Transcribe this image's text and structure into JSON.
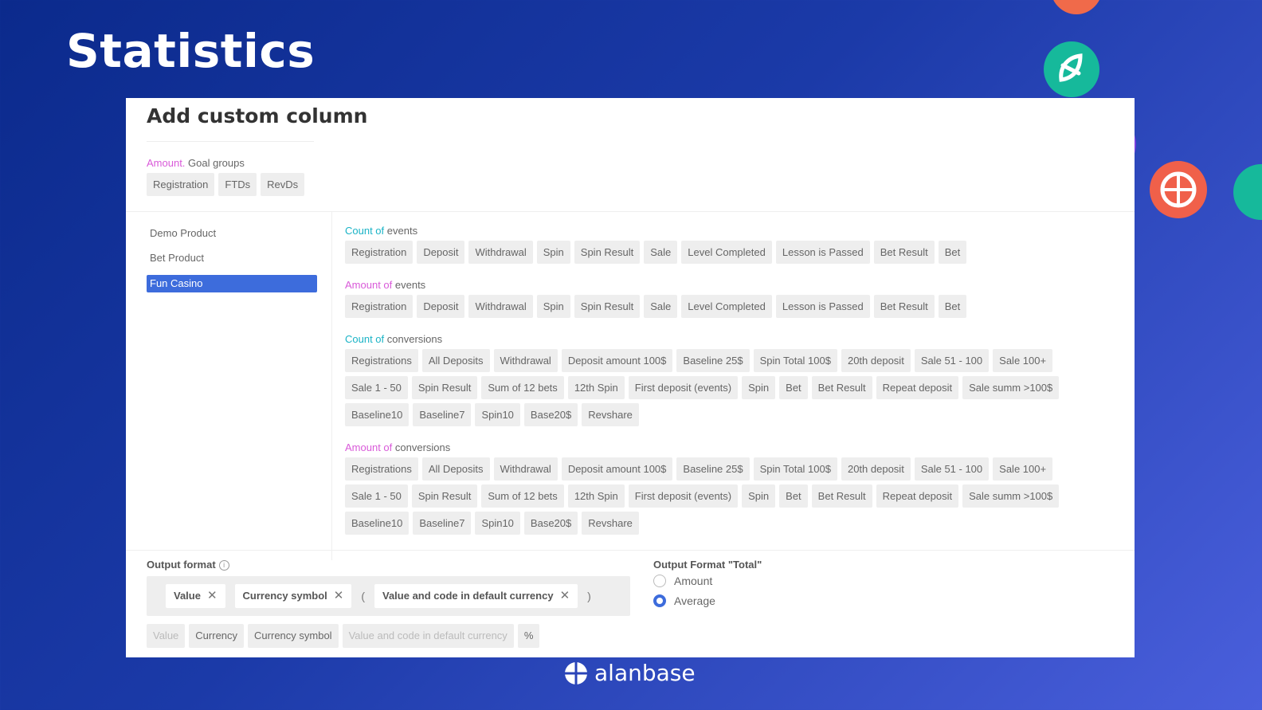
{
  "page": {
    "title": "Statistics"
  },
  "dialog": {
    "title": "Add custom column",
    "goal_groups": {
      "prefix": "Amount.",
      "label": " Goal groups",
      "items": [
        "Registration",
        "FTDs",
        "RevDs"
      ]
    },
    "products": [
      {
        "label": "Demo Product"
      },
      {
        "label": "Bet Product"
      },
      {
        "label": "Fun Casino",
        "selected": true
      }
    ],
    "count_events": {
      "prefix": "Count of",
      "label": " events",
      "items": [
        "Registration",
        "Deposit",
        "Withdrawal",
        "Spin",
        "Spin Result",
        "Sale",
        "Level Completed",
        "Lesson is Passed",
        "Bet Result",
        "Bet"
      ]
    },
    "amount_events": {
      "prefix": "Amount of",
      "label": " events",
      "items": [
        "Registration",
        "Deposit",
        "Withdrawal",
        "Spin",
        "Spin Result",
        "Sale",
        "Level Completed",
        "Lesson is Passed",
        "Bet Result",
        "Bet"
      ]
    },
    "count_conversions": {
      "prefix": "Count of",
      "label": " conversions",
      "items": [
        "Registrations",
        "All Deposits",
        "Withdrawal",
        "Deposit amount 100$",
        "Baseline 25$",
        "Spin Total 100$",
        "20th deposit",
        "Sale 51 - 100",
        "Sale 100+",
        "Sale 1 - 50",
        "Spin Result",
        "Sum of 12 bets",
        "12th Spin",
        "First deposit (events)",
        "Spin",
        "Bet",
        "Bet Result",
        "Repeat deposit",
        "Sale summ >100$",
        "Baseline10",
        "Baseline7",
        "Spin10",
        "Base20$",
        "Revshare"
      ]
    },
    "amount_conversions": {
      "prefix": "Amount of",
      "label": " conversions",
      "items": [
        "Registrations",
        "All Deposits",
        "Withdrawal",
        "Deposit amount 100$",
        "Baseline 25$",
        "Spin Total 100$",
        "20th deposit",
        "Sale 51 - 100",
        "Sale 100+",
        "Sale 1 - 50",
        "Spin Result",
        "Sum of 12 bets",
        "12th Spin",
        "First deposit (events)",
        "Spin",
        "Bet",
        "Bet Result",
        "Repeat deposit",
        "Sale summ >100$",
        "Baseline10",
        "Baseline7",
        "Spin10",
        "Base20$",
        "Revshare"
      ]
    },
    "output_format": {
      "label": "Output format",
      "info_icon": "i",
      "tags": [
        "Value",
        "Currency symbol",
        "Value and code in default currency"
      ],
      "close_glyph": "✕",
      "open_paren": "(",
      "close_paren": ")",
      "options": [
        {
          "label": "Value",
          "disabled": true
        },
        {
          "label": "Currency",
          "disabled": false
        },
        {
          "label": "Currency symbol",
          "disabled": false
        },
        {
          "label": "Value and code in default currency",
          "disabled": true
        },
        {
          "label": "%",
          "disabled": false
        }
      ]
    },
    "output_total": {
      "label": "Output Format \"Total\"",
      "options": [
        {
          "label": "Amount",
          "checked": false
        },
        {
          "label": "Average",
          "checked": true
        }
      ]
    }
  },
  "brand": {
    "name": "alanbase"
  },
  "colors": {
    "accent": "#3d6cdc",
    "amount_kw": "#d95ad9",
    "count_kw": "#1ab3c6"
  }
}
